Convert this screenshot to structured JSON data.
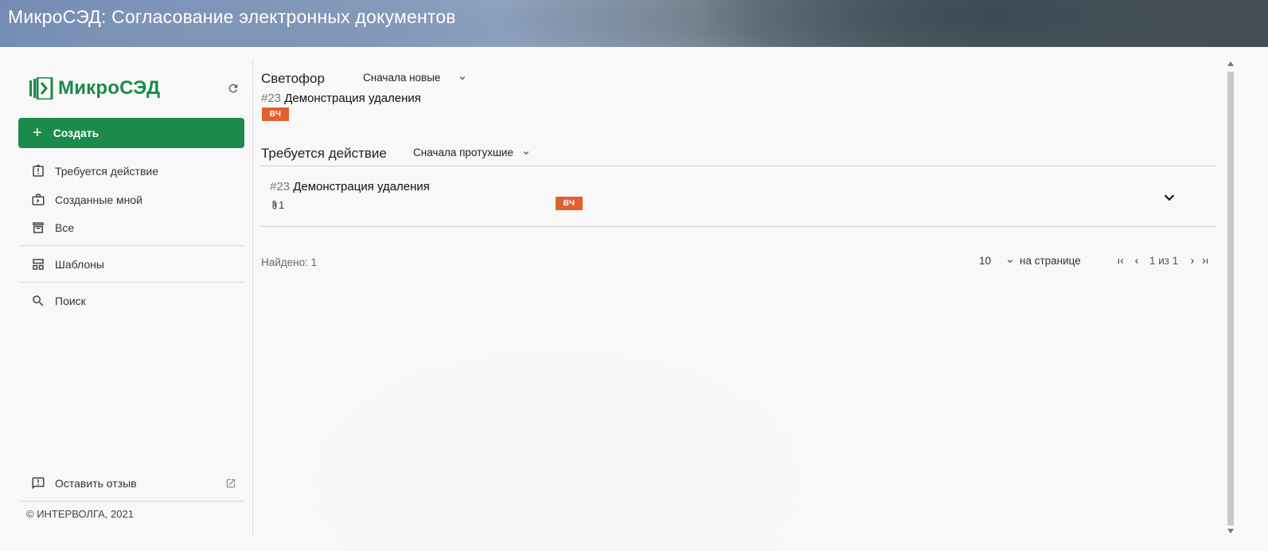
{
  "header": {
    "title": "МикроСЭД: Согласование электронных документов"
  },
  "sidebar": {
    "logo_text": "МикроСЭД",
    "create_label": "Создать",
    "items": [
      {
        "label": "Требуется действие",
        "icon": "clipboard-alert-icon"
      },
      {
        "label": "Созданные мной",
        "icon": "briefcase-icon"
      },
      {
        "label": "Все",
        "icon": "archive-icon"
      },
      {
        "label": "Шаблоны",
        "icon": "templates-icon"
      },
      {
        "label": "Поиск",
        "icon": "search-icon"
      }
    ],
    "feedback_label": "Оставить отзыв",
    "copyright": "© ИНТЕРВОЛГА, 2021"
  },
  "traffic": {
    "title": "Светофор",
    "sort": "Сначала новые",
    "doc_num": "#23",
    "doc_title": "Демонстрация удаления",
    "badge": "ВЧ"
  },
  "action": {
    "title": "Требуется действие",
    "sort": "Сначала протухшие",
    "rows": [
      {
        "num": "#23",
        "title": "Демонстрация удаления",
        "attachments": "1",
        "badge": "ВЧ"
      }
    ]
  },
  "footer": {
    "found": "Найдено: 1",
    "per_page_value": "10",
    "per_page_label": "на странице",
    "range": "1 из 1"
  },
  "colors": {
    "primary": "#1b8a4a",
    "badge": "#e2602f"
  }
}
